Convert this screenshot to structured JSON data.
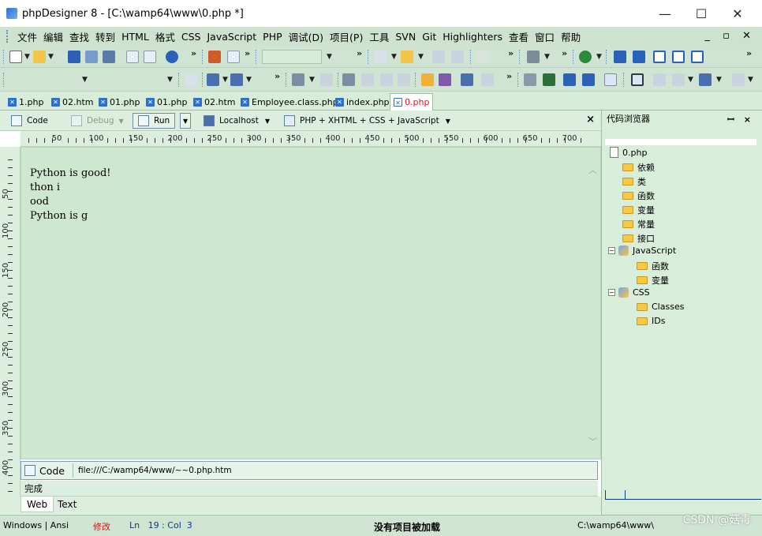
{
  "window": {
    "title": "phpDesigner 8 - [C:\\wamp64\\www\\0.php *]",
    "controls": {
      "minimize": "—",
      "maximize": "☐",
      "close": "✕"
    }
  },
  "menu": {
    "items": [
      "文件",
      "编辑",
      "查找",
      "转到",
      "HTML",
      "格式",
      "CSS",
      "JavaScript",
      "PHP",
      "调试(D)",
      "项目(P)",
      "工具",
      "SVN",
      "Git",
      "Highlighters",
      "查看",
      "窗口",
      "帮助"
    ],
    "mdi_controls": "_ ▫ ✕"
  },
  "toolbar": {
    "overflow": "»"
  },
  "doc_tabs": [
    {
      "label": "1.php",
      "active": false
    },
    {
      "label": "02.htm",
      "active": false
    },
    {
      "label": "01.php",
      "active": false
    },
    {
      "label": "01.php",
      "active": false
    },
    {
      "label": "02.htm",
      "active": false
    },
    {
      "label": "Employee.class.php",
      "active": false
    },
    {
      "label": "index.php",
      "active": false
    },
    {
      "label": "0.php",
      "active": true
    }
  ],
  "editor_toolbar": {
    "code": "Code",
    "debug": "Debug",
    "run": "Run",
    "localhost": "Localhost",
    "highlighter": "PHP + XHTML + CSS + JavaScript",
    "close": "×"
  },
  "ruler": {
    "labels": [
      "50",
      "100",
      "150",
      "200",
      "250",
      "300",
      "350",
      "400",
      "450",
      "500",
      "550",
      "600",
      "650",
      "700"
    ]
  },
  "gutter": {
    "labels": [
      "50",
      "100",
      "150",
      "200",
      "250",
      "300",
      "350",
      "400"
    ]
  },
  "editor": {
    "lines": [
      "Python is good!",
      "thon i",
      "ood",
      "Python is g"
    ]
  },
  "preview": {
    "label": "Code",
    "url": "file:///C:/wamp64/www/~~0.php.htm",
    "status": "完成"
  },
  "bottom_tabs": [
    {
      "label": "Web",
      "active": true
    },
    {
      "label": "Text",
      "active": false
    }
  ],
  "code_explorer": {
    "title": "代码浏览器",
    "pin": "ꟷ ×",
    "tree": [
      {
        "label": "0.php",
        "level": 0,
        "kind": "file"
      },
      {
        "label": "依赖",
        "level": 1,
        "kind": "folder"
      },
      {
        "label": "类",
        "level": 1,
        "kind": "folder"
      },
      {
        "label": "函数",
        "level": 1,
        "kind": "folder"
      },
      {
        "label": "变量",
        "level": 1,
        "kind": "folder"
      },
      {
        "label": "常量",
        "level": 1,
        "kind": "folder"
      },
      {
        "label": "接口",
        "level": 1,
        "kind": "folder"
      },
      {
        "label": "JavaScript",
        "level": 1,
        "kind": "group"
      },
      {
        "label": "函数",
        "level": 2,
        "kind": "folder"
      },
      {
        "label": "变量",
        "level": 2,
        "kind": "folder"
      },
      {
        "label": "CSS",
        "level": 1,
        "kind": "group"
      },
      {
        "label": "Classes",
        "level": 2,
        "kind": "folder"
      },
      {
        "label": "IDs",
        "level": 2,
        "kind": "folder"
      }
    ]
  },
  "statusbar": {
    "encoding": "Windows | Ansi",
    "modified": "修改",
    "position": "Ln   19 : Col  3",
    "project": "没有项目被加载",
    "path": "C:\\wamp64\\www\\"
  },
  "watermark": "CSDN @菇毒"
}
